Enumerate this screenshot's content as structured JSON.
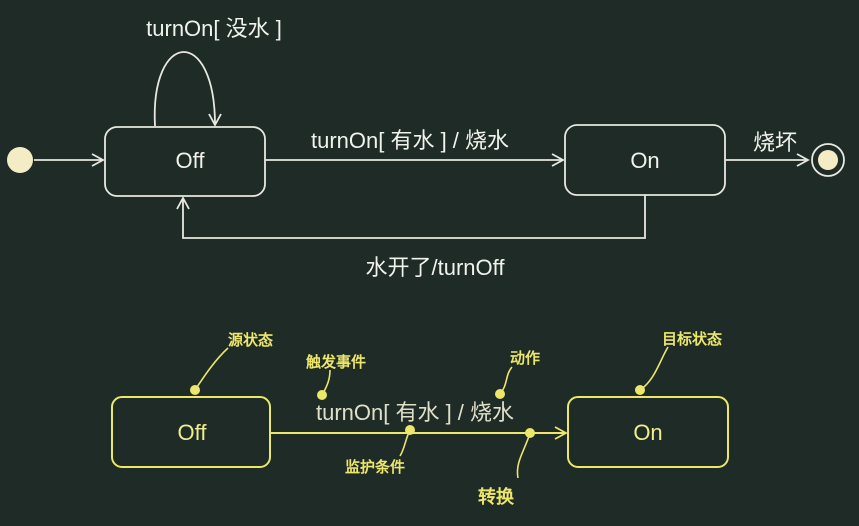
{
  "colors": {
    "background": "#1e2b27",
    "line": "#e8e8e0",
    "initial_state": "#f4ecc4",
    "annotation": "#ece66a"
  },
  "top": {
    "states": {
      "off": "Off",
      "on": "On"
    },
    "self_loop_label": "turnOn[ 没水 ]",
    "transition_label": "turnOn[ 有水 ] / 烧水",
    "final_label": "烧坏",
    "return_label": "水开了/turnOff"
  },
  "bottom": {
    "states": {
      "off": "Off",
      "on": "On"
    },
    "transition_label": "turnOn[ 有水 ] / 烧水",
    "annotations": {
      "source_state": "源状态",
      "trigger_event": "触发事件",
      "action": "动作",
      "target_state": "目标状态",
      "guard_condition": "监护条件",
      "transition": "转换"
    }
  }
}
